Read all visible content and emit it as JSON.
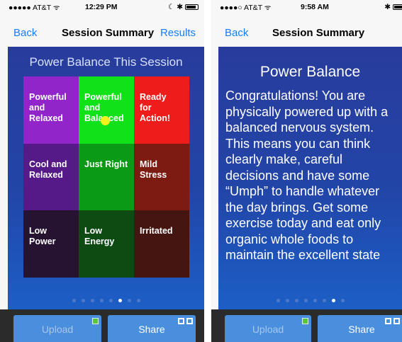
{
  "left": {
    "status": {
      "carrier": "●●●●● AT&T ᯤ",
      "time": "12:29 PM",
      "icons": "☾ ✱"
    },
    "nav": {
      "back": "Back",
      "title": "Session Summary",
      "results": "Results"
    },
    "grid_title": "Power Balance This Session",
    "grid": [
      {
        "label": "Powerful\nand\nRelaxed",
        "color": "#9225c9"
      },
      {
        "label": "Powerful\nand\nBalanced",
        "color": "#11e118"
      },
      {
        "label": "Ready\nfor\nAction!",
        "color": "#ee1d1b"
      },
      {
        "label": "Cool and\nRelaxed",
        "color": "#551a88"
      },
      {
        "label": "Just Right",
        "color": "#0a9a16"
      },
      {
        "label": "Mild\nStress",
        "color": "#7c1b12"
      },
      {
        "label": "Low\nPower",
        "color": "#261332"
      },
      {
        "label": "Low\nEnergy",
        "color": "#0d4b13"
      },
      {
        "label": "Irritated",
        "color": "#451511"
      }
    ],
    "pager": {
      "count": 8,
      "active": 5
    },
    "buttons": {
      "upload": "Upload",
      "share": "Share"
    }
  },
  "right": {
    "status": {
      "carrier": "●●●●○ AT&T ᯤ",
      "time": "9:58 AM",
      "icons": "✱"
    },
    "nav": {
      "back": "Back",
      "title": "Session Summary"
    },
    "summary_title": "Power Balance",
    "summary_text": "Congratulations! You are physically powered up with a balanced nervous system. This means you can think clearly make, careful decisions and have some “Umph” to handle whatever the day brings. Get some exercise today and eat only organic whole foods to maintain the excellent state",
    "pager": {
      "count": 8,
      "active": 6
    },
    "buttons": {
      "upload": "Upload",
      "share": "Share"
    }
  },
  "colors": {
    "accent": "#1a7cf3",
    "button": "#4a8fdd",
    "marker": "#f1f11b"
  }
}
